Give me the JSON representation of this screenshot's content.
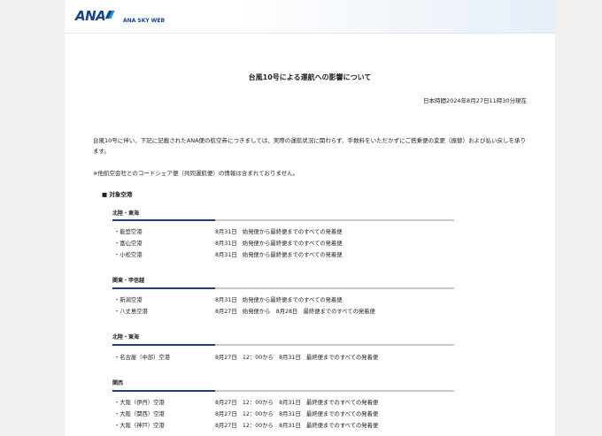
{
  "header": {
    "logo_text": "ANA",
    "brand_subtitle": "ANA SKY WEB"
  },
  "title": "台風10号による運航への影響について",
  "timestamp": "日本時間2024年8月27日11時30分現在",
  "intro": "台風10号に伴い、下記に記載されたANA便の航空券につきましては、実際の運航状況に関わらず、手数料をいただかずにご搭乗便の変更（振替）および払い戻しを承ります。",
  "note": "※他航空会社とのコードシェア便（共同運航便）の情報は含まれておりません。",
  "airport_heading": "■ 対象空港",
  "regions": [
    {
      "name": "北陸・東海",
      "rows": [
        {
          "airport": "・能登空港",
          "detail": "8月31日　始発便から最終便までのすべての発着便"
        },
        {
          "airport": "・富山空港",
          "detail": "8月31日　始発便から最終便までのすべての発着便"
        },
        {
          "airport": "・小松空港",
          "detail": "8月31日　始発便から最終便までのすべての発着便"
        }
      ]
    },
    {
      "name": "関東・甲信越",
      "rows": [
        {
          "airport": "・新潟空港",
          "detail": "8月31日　始発便から最終便までのすべての発着便"
        },
        {
          "airport": "・八丈島空港",
          "detail": "8月27日　始発便から　8月28日　最終便までのすべての発着便"
        }
      ]
    },
    {
      "name": "北陸・東海",
      "rows": [
        {
          "airport": "・名古屋（中部）空港",
          "detail": "8月27日　12：00から　8月31日　最終便までのすべての発着便"
        }
      ]
    },
    {
      "name": "関西",
      "rows": [
        {
          "airport": "・大阪（伊丹）空港",
          "detail": "8月27日　12：00から　8月31日　最終便までのすべての発着便"
        },
        {
          "airport": "・大阪（関西）空港",
          "detail": "8月27日　12：00から　8月31日　最終便までのすべての発着便"
        },
        {
          "airport": "・大阪（神戸）空港",
          "detail": "8月27日　12：00から　8月31日　最終便までのすべての発着便"
        }
      ]
    }
  ]
}
